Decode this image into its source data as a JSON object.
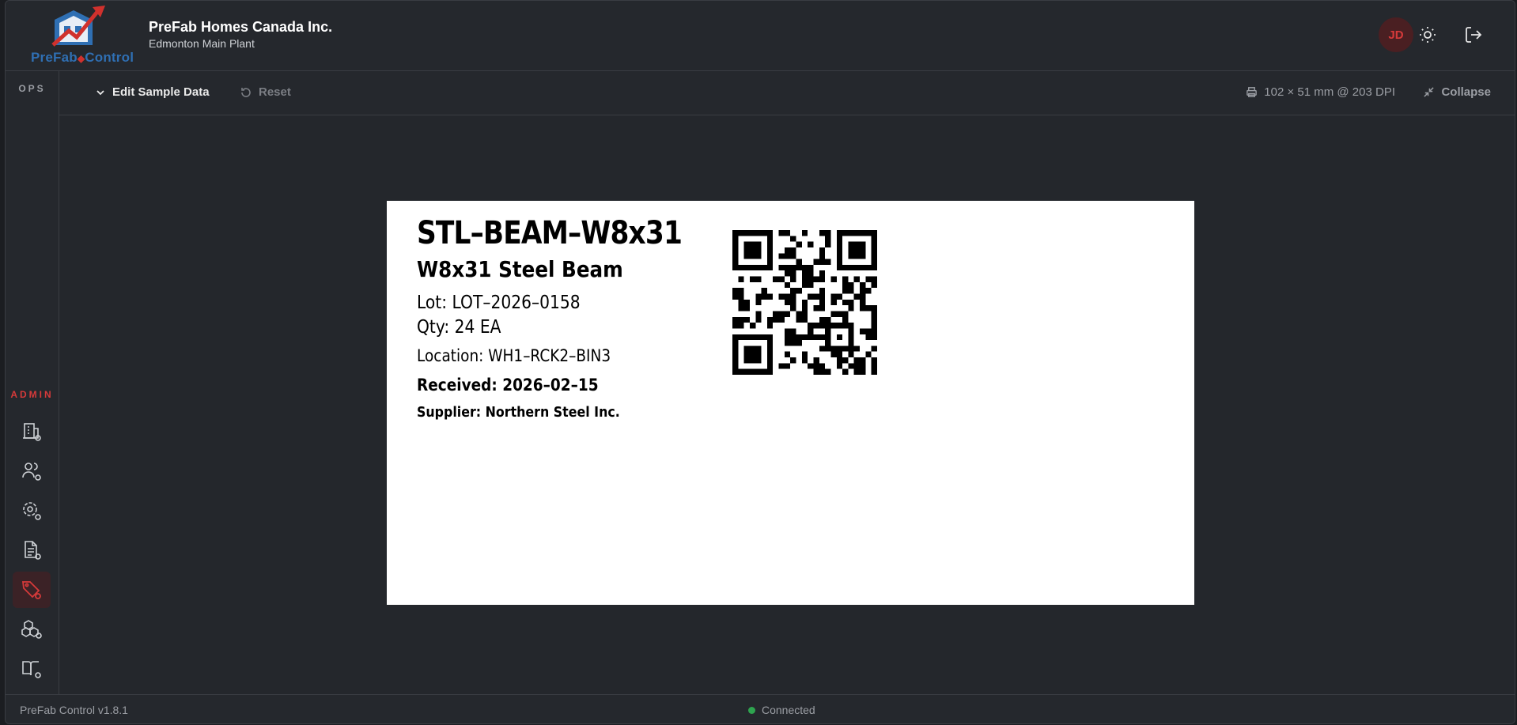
{
  "header": {
    "logo_text_a": "PreFab",
    "logo_text_b": "Control",
    "company": "PreFab Homes Canada Inc.",
    "plant": "Edmonton Main Plant",
    "avatar_initials": "JD"
  },
  "sidebar": {
    "section_ops": "OPS",
    "section_admin": "ADMIN",
    "items": [
      {
        "icon": "building-settings-icon"
      },
      {
        "icon": "users-settings-icon"
      },
      {
        "icon": "gear-settings-icon"
      },
      {
        "icon": "document-settings-icon"
      },
      {
        "icon": "tag-settings-icon",
        "active": true
      },
      {
        "icon": "boxes-settings-icon"
      },
      {
        "icon": "book-settings-icon"
      }
    ]
  },
  "toolbar": {
    "edit_label": "Edit Sample Data",
    "reset_label": "Reset",
    "dimensions": "102 × 51 mm @ 203 DPI",
    "collapse_label": "Collapse"
  },
  "label": {
    "code": "STL–BEAM–W8x31",
    "name": "W8x31 Steel Beam",
    "lot": "Lot: LOT–2026–0158",
    "qty": "Qty: 24 EA",
    "location": "Location: WH1–RCK2–BIN3",
    "received": "Received: 2026–02–15",
    "supplier": "Supplier: Northern Steel Inc."
  },
  "footer": {
    "version": "PreFab Control v1.8.1",
    "status": "Connected"
  },
  "colors": {
    "accent": "#d63a3a",
    "status_ok": "#2ea44f",
    "brand_blue": "#2f6fb3"
  }
}
